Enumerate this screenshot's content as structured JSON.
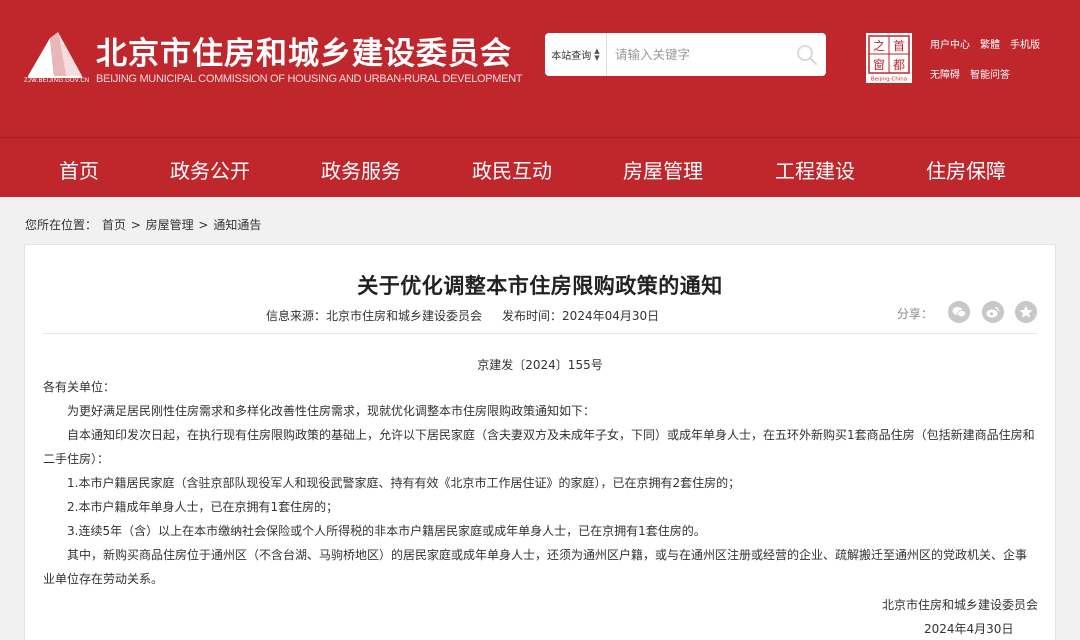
{
  "header": {
    "logo_domain": "ZJW.BEIJING.GOV.CN",
    "title": "北京市住房和城乡建设委员会",
    "subtitle": "BEIJING MUNICIPAL COMMISSION OF HOUSING AND URBAN-RURAL DEVELOPMENT",
    "search": {
      "scope": "本站查询",
      "placeholder": "请输入关键字"
    },
    "capital_logo_text": "Beijing·China",
    "links_row1": [
      "用户中心",
      "繁體",
      "手机版"
    ],
    "links_row2": [
      "无障碍",
      "智能问答"
    ],
    "brand_color": "#c0272d"
  },
  "nav": [
    "首页",
    "政务公开",
    "政务服务",
    "政民互动",
    "房屋管理",
    "工程建设",
    "住房保障"
  ],
  "breadcrumb": {
    "prefix": "您所在位置：",
    "items": [
      "首页",
      "房屋管理",
      "通知通告"
    ],
    "separator": ">"
  },
  "article": {
    "title": "关于优化调整本市住房限购政策的通知",
    "source_label": "信息来源：",
    "source": "北京市住房和城乡建设委员会",
    "date_label": "发布时间：",
    "date": "2024年04月30日",
    "share_label": "分享：",
    "share_icons": [
      "wechat-icon",
      "weibo-icon",
      "favorite-icon"
    ],
    "doc_no": "京建发〔2024〕155号",
    "salutation": "各有关单位：",
    "paragraphs": [
      "为更好满足居民刚性住房需求和多样化改善性住房需求，现就优化调整本市住房限购政策通知如下：",
      "自本通知印发次日起，在执行现有住房限购政策的基础上，允许以下居民家庭（含夫妻双方及未成年子女，下同）或成年单身人士，在五环外新购买1套商品住房（包括新建商品住房和二手住房）：",
      "1.本市户籍居民家庭（含驻京部队现役军人和现役武警家庭、持有有效《北京市工作居住证》的家庭），已在京拥有2套住房的；",
      "2.本市户籍成年单身人士，已在京拥有1套住房的；",
      "3.连续5年（含）以上在本市缴纳社会保险或个人所得税的非本市户籍居民家庭或成年单身人士，已在京拥有1套住房的。",
      "其中，新购买商品住房位于通州区（不含台湖、马驹桥地区）的居民家庭或成年单身人士，还须为通州区户籍，或与在通州区注册或经营的企业、疏解搬迁至通州区的党政机关、企事业单位存在劳动关系。"
    ],
    "signature": "北京市住房和城乡建设委员会",
    "sign_date": "2024年4月30日"
  }
}
